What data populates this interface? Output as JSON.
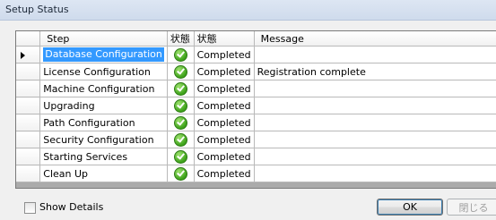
{
  "window": {
    "title": "Setup Status"
  },
  "grid": {
    "columns": [
      "Step",
      "状態",
      "状態",
      "Message"
    ],
    "rows": [
      {
        "step": "Database Configuration",
        "icon": "check-icon",
        "status": "Completed",
        "message": ""
      },
      {
        "step": "License Configuration",
        "icon": "check-icon",
        "status": "Completed",
        "message": "Registration complete"
      },
      {
        "step": "Machine Configuration",
        "icon": "check-icon",
        "status": "Completed",
        "message": ""
      },
      {
        "step": "Upgrading",
        "icon": "check-icon",
        "status": "Completed",
        "message": ""
      },
      {
        "step": "Path Configuration",
        "icon": "check-icon",
        "status": "Completed",
        "message": ""
      },
      {
        "step": "Security Configuration",
        "icon": "check-icon",
        "status": "Completed",
        "message": ""
      },
      {
        "step": "Starting Services",
        "icon": "check-icon",
        "status": "Completed",
        "message": ""
      },
      {
        "step": "Clean Up",
        "icon": "check-icon",
        "status": "Completed",
        "message": ""
      }
    ]
  },
  "footer": {
    "show_details_label": "Show Details",
    "show_details_checked": false,
    "ok_label": "OK",
    "close_label": "閉じる"
  },
  "colors": {
    "selection": "#3399ff",
    "check": "#3da21a",
    "title_bar": "#dde6f3"
  }
}
